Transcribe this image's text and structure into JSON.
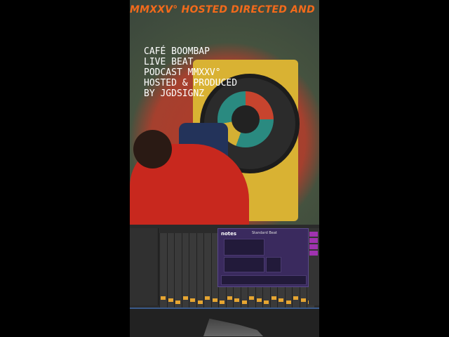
{
  "ticker": {
    "text": "MMXXV° HOSTED DIRECTED AND"
  },
  "overlay": {
    "lines": [
      "CAFÉ BOOMBAP",
      "LIVE BEAT",
      "PODCAST MMXXV°",
      "HOSTED & PRODUCED",
      "BY JGDSIGNZ"
    ]
  },
  "plugin": {
    "logo": "notes",
    "preset": "Standard Beat"
  },
  "colors": {
    "ticker": "#f26a1b",
    "accent": "#e6a531",
    "plugin_bg": "#3a2a5e"
  }
}
